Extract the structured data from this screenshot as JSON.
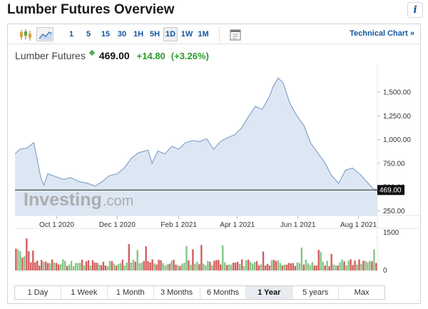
{
  "page": {
    "title": "Lumber Futures Overview",
    "info_label": "i"
  },
  "toolbar": {
    "icons": [
      "candlestick-icon",
      "area-chart-icon",
      "settings-panel-icon"
    ],
    "intervals": [
      "1",
      "5",
      "15",
      "30",
      "1H",
      "5H",
      "1D",
      "1W",
      "1M"
    ],
    "selected_interval": "1D",
    "technical_link": "Technical Chart »"
  },
  "quote": {
    "name": "Lumber Futures",
    "price": "469.00",
    "change": "+14.80",
    "change_pct": "(+3.26%)",
    "up_color": "#2b9a2b"
  },
  "watermark": {
    "brand": "Investing",
    "suffix": ".com"
  },
  "periods": {
    "items": [
      "1 Day",
      "1 Week",
      "1 Month",
      "3 Months",
      "6 Months",
      "1 Year",
      "5 years",
      "Max"
    ],
    "selected": "1 Year"
  },
  "chart_data": {
    "type": "area",
    "title": "",
    "xlabel": "",
    "ylabel": "",
    "x_ticks": [
      "Oct 1 2020",
      "Dec 1 2020",
      "Feb 1 2021",
      "Apr 1 2021",
      "Jun 1 2021",
      "Aug 1 2021"
    ],
    "y_ticks": [
      "1,500.00",
      "1,250.00",
      "1,000.00",
      "750.00",
      "500.00",
      "250.00"
    ],
    "y_range": [
      200,
      1750
    ],
    "last_value_label": "469.00",
    "last_value": 469,
    "series": [
      {
        "x": [
          "2020-08-20",
          "2020-08-25",
          "2020-09-01",
          "2020-09-08",
          "2020-09-15",
          "2020-09-18",
          "2020-09-22",
          "2020-09-30",
          "2020-10-08",
          "2020-10-15",
          "2020-10-23",
          "2020-11-01",
          "2020-11-09",
          "2020-11-16",
          "2020-11-23",
          "2020-12-01",
          "2020-12-08",
          "2020-12-15",
          "2020-12-22",
          "2021-01-01",
          "2021-01-05",
          "2021-01-11",
          "2021-01-18",
          "2021-01-25",
          "2021-02-01",
          "2021-02-08",
          "2021-02-15",
          "2021-02-22",
          "2021-03-01",
          "2021-03-08",
          "2021-03-15",
          "2021-03-22",
          "2021-03-29",
          "2021-04-05",
          "2021-04-12",
          "2021-04-19",
          "2021-04-26",
          "2021-05-03",
          "2021-05-07",
          "2021-05-12",
          "2021-05-17",
          "2021-05-24",
          "2021-05-31",
          "2021-06-07",
          "2021-06-14",
          "2021-06-21",
          "2021-06-28",
          "2021-07-05",
          "2021-07-12",
          "2021-07-19",
          "2021-07-26",
          "2021-08-02",
          "2021-08-09",
          "2021-08-16",
          "2021-08-20"
        ],
        "values": [
          850,
          900,
          910,
          970,
          600,
          520,
          640,
          610,
          580,
          600,
          560,
          540,
          510,
          560,
          620,
          640,
          700,
          800,
          860,
          890,
          750,
          880,
          850,
          930,
          900,
          970,
          990,
          980,
          1010,
          900,
          980,
          1020,
          1050,
          1120,
          1240,
          1350,
          1320,
          1450,
          1560,
          1650,
          1600,
          1380,
          1250,
          1150,
          960,
          860,
          760,
          620,
          540,
          680,
          700,
          640,
          560,
          480,
          469
        ]
      }
    ],
    "volume": {
      "y_ticks": [
        "1500",
        "0"
      ],
      "y_range": [
        0,
        1600
      ]
    },
    "colors": {
      "line": "#7c9cc6",
      "area": "#dde7f3",
      "vol_up": "#86c486",
      "vol_down": "#d45d5d",
      "price_label_bg": "#111111"
    }
  }
}
